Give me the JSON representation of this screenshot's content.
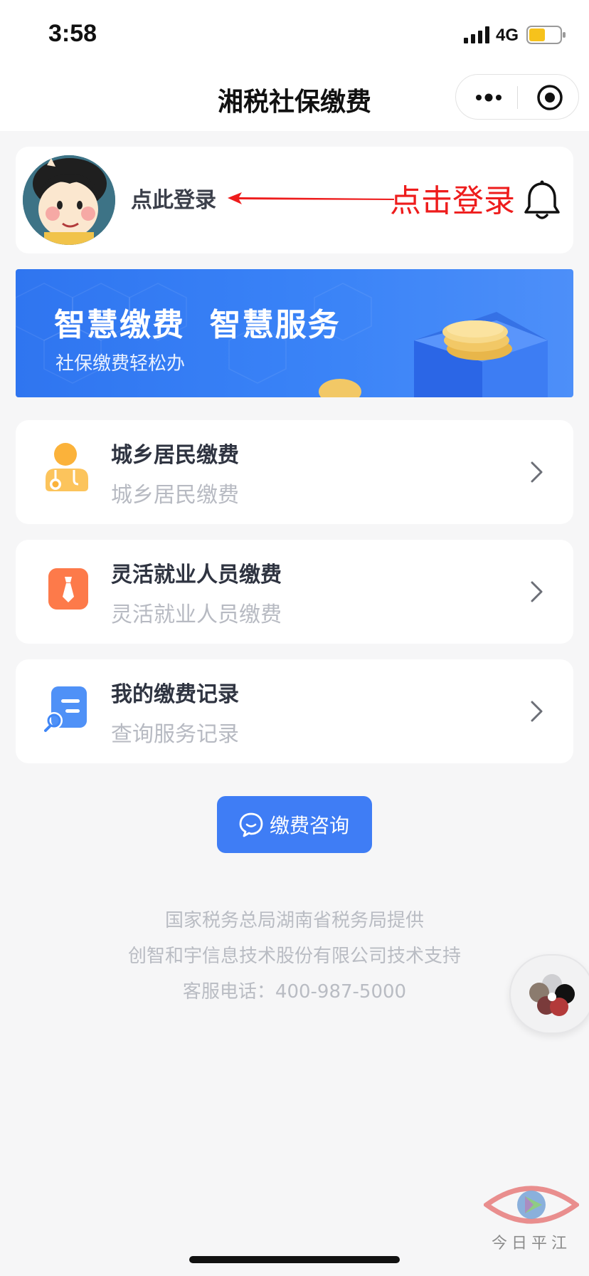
{
  "status_bar": {
    "time": "3:58",
    "network": "4G",
    "battery_color": "#f6c21c"
  },
  "nav": {
    "title": "湘税社保缴费",
    "more_icon": "more-dots-icon",
    "close_icon": "mini-program-close-icon"
  },
  "user": {
    "login_text": "点此登录",
    "annotation": "点击登录",
    "annotation_color": "#ee1c1c",
    "notification_icon": "bell-icon"
  },
  "banner": {
    "title": "智慧缴费  智慧服务",
    "subtitle": "社保缴费轻松办"
  },
  "services": [
    {
      "title": "城乡居民缴费",
      "subtitle": "城乡居民缴费",
      "icon": "resident-icon",
      "color": "#fbb23a"
    },
    {
      "title": "灵活就业人员缴费",
      "subtitle": "灵活就业人员缴费",
      "icon": "tie-icon",
      "color": "#fb6a3e"
    },
    {
      "title": "我的缴费记录",
      "subtitle": "查询服务记录",
      "icon": "record-icon",
      "color": "#3f86f6"
    }
  ],
  "consult": {
    "label": "缴费咨询",
    "icon": "chat-icon"
  },
  "footer": {
    "line1": "国家税务总局湖南省税务局提供",
    "line2": "创智和宇信息技术股份有限公司技术支持",
    "line3": "客服电话：400-987-5000"
  },
  "watermark": {
    "text": "今日平江"
  },
  "accent_color": "#3f7df5"
}
